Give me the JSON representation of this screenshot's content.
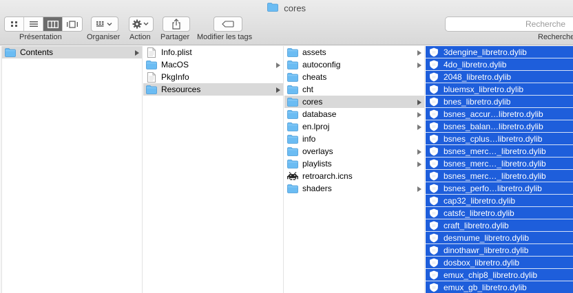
{
  "window": {
    "title": "cores"
  },
  "toolbar": {
    "presentation_label": "Présentation",
    "organiser_label": "Organiser",
    "action_label": "Action",
    "partager_label": "Partager",
    "tags_label": "Modifier les tags",
    "search_label": "Recherche",
    "search_placeholder": "Recherche"
  },
  "columns": [
    {
      "items": [
        {
          "name": "Contents",
          "icon": "folder-icon",
          "folder": true,
          "state": "gray"
        }
      ]
    },
    {
      "items": [
        {
          "name": "Info.plist",
          "icon": "document-icon",
          "folder": false,
          "state": ""
        },
        {
          "name": "MacOS",
          "icon": "folder-icon",
          "folder": true,
          "state": ""
        },
        {
          "name": "PkgInfo",
          "icon": "document-icon",
          "folder": false,
          "state": ""
        },
        {
          "name": "Resources",
          "icon": "folder-icon",
          "folder": true,
          "state": "gray"
        }
      ]
    },
    {
      "items": [
        {
          "name": "assets",
          "icon": "folder-icon",
          "folder": true,
          "state": ""
        },
        {
          "name": "autoconfig",
          "icon": "folder-icon",
          "folder": true,
          "state": ""
        },
        {
          "name": "cheats",
          "icon": "folder-icon",
          "folder": false,
          "state": ""
        },
        {
          "name": "cht",
          "icon": "folder-icon",
          "folder": false,
          "state": ""
        },
        {
          "name": "cores",
          "icon": "folder-icon",
          "folder": true,
          "state": "gray"
        },
        {
          "name": "database",
          "icon": "folder-icon",
          "folder": true,
          "state": ""
        },
        {
          "name": "en.lproj",
          "icon": "folder-icon",
          "folder": true,
          "state": ""
        },
        {
          "name": "info",
          "icon": "folder-icon",
          "folder": false,
          "state": ""
        },
        {
          "name": "overlays",
          "icon": "folder-icon",
          "folder": true,
          "state": ""
        },
        {
          "name": "playlists",
          "icon": "folder-icon",
          "folder": true,
          "state": ""
        },
        {
          "name": "retroarch.icns",
          "icon": "invader-icon",
          "folder": false,
          "state": ""
        },
        {
          "name": "shaders",
          "icon": "folder-icon",
          "folder": true,
          "state": ""
        }
      ]
    },
    {
      "items": [
        {
          "name": "3dengine_libretro.dylib",
          "icon": "dylib-icon",
          "folder": false,
          "state": "sel"
        },
        {
          "name": "4do_libretro.dylib",
          "icon": "dylib-icon",
          "folder": false,
          "state": "sel"
        },
        {
          "name": "2048_libretro.dylib",
          "icon": "dylib-icon",
          "folder": false,
          "state": "sel"
        },
        {
          "name": "bluemsx_libretro.dylib",
          "icon": "dylib-icon",
          "folder": false,
          "state": "sel"
        },
        {
          "name": "bnes_libretro.dylib",
          "icon": "dylib-icon",
          "folder": false,
          "state": "sel"
        },
        {
          "name": "bsnes_accur…libretro.dylib",
          "icon": "dylib-icon",
          "folder": false,
          "state": "sel"
        },
        {
          "name": "bsnes_balan…libretro.dylib",
          "icon": "dylib-icon",
          "folder": false,
          "state": "sel"
        },
        {
          "name": "bsnes_cplus…libretro.dylib",
          "icon": "dylib-icon",
          "folder": false,
          "state": "sel"
        },
        {
          "name": "bsnes_merc…_libretro.dylib",
          "icon": "dylib-icon",
          "folder": false,
          "state": "sel"
        },
        {
          "name": "bsnes_merc…_libretro.dylib",
          "icon": "dylib-icon",
          "folder": false,
          "state": "sel"
        },
        {
          "name": "bsnes_merc…_libretro.dylib",
          "icon": "dylib-icon",
          "folder": false,
          "state": "sel"
        },
        {
          "name": "bsnes_perfo…libretro.dylib",
          "icon": "dylib-icon",
          "folder": false,
          "state": "sel"
        },
        {
          "name": "cap32_libretro.dylib",
          "icon": "dylib-icon",
          "folder": false,
          "state": "sel"
        },
        {
          "name": "catsfc_libretro.dylib",
          "icon": "dylib-icon",
          "folder": false,
          "state": "sel"
        },
        {
          "name": "craft_libretro.dylib",
          "icon": "dylib-icon",
          "folder": false,
          "state": "sel"
        },
        {
          "name": "desmume_libretro.dylib",
          "icon": "dylib-icon",
          "folder": false,
          "state": "sel"
        },
        {
          "name": "dinothawr_libretro.dylib",
          "icon": "dylib-icon",
          "folder": false,
          "state": "sel"
        },
        {
          "name": "dosbox_libretro.dylib",
          "icon": "dylib-icon",
          "folder": false,
          "state": "sel"
        },
        {
          "name": "emux_chip8_libretro.dylib",
          "icon": "dylib-icon",
          "folder": false,
          "state": "sel"
        },
        {
          "name": "emux_gb_libretro.dylib",
          "icon": "dylib-icon",
          "folder": false,
          "state": "sel"
        }
      ]
    }
  ],
  "colors": {
    "selection": "#1e5edb",
    "folder": "#5fb4f0",
    "inactive_selection": "#d9d9d9"
  }
}
